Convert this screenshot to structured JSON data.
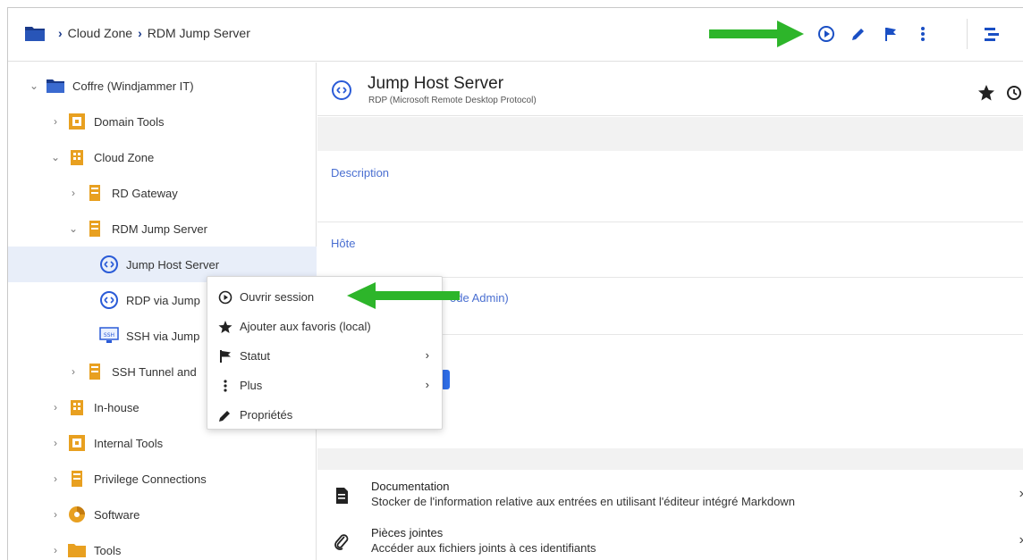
{
  "breadcrumb": {
    "items": [
      "Cloud Zone",
      "RDM Jump Server"
    ]
  },
  "toolbar": {
    "icons": [
      "play-circle-icon",
      "pencil-icon",
      "flag-icon",
      "more-vertical-icon",
      "tree-toggle-icon"
    ]
  },
  "tree": {
    "root": "Coffre (Windjammer IT)",
    "items": [
      {
        "label": "Domain Tools",
        "icon": "domain-tools-icon"
      },
      {
        "label": "Cloud Zone",
        "icon": "building-icon"
      },
      {
        "label": "RD Gateway",
        "icon": "server-icon"
      },
      {
        "label": "RDM Jump Server",
        "icon": "server-icon"
      },
      {
        "label": "Jump Host Server",
        "icon": "rdp-icon"
      },
      {
        "label": "RDP via Jump",
        "icon": "rdp-icon"
      },
      {
        "label": "SSH via Jump",
        "icon": "ssh-icon"
      },
      {
        "label": "SSH Tunnel and",
        "icon": "server-icon"
      },
      {
        "label": "In-house",
        "icon": "building-icon"
      },
      {
        "label": "Internal Tools",
        "icon": "domain-tools-icon"
      },
      {
        "label": "Privilege Connections",
        "icon": "server-icon"
      },
      {
        "label": "Software",
        "icon": "software-disc-icon"
      },
      {
        "label": "Tools",
        "icon": "folder-icon"
      }
    ]
  },
  "detail": {
    "title": "Jump Host Server",
    "subtitle": "RDP (Microsoft Remote Desktop Protocol)",
    "description_label": "Description",
    "host_label": "Hôte",
    "mode_admin_fragment": "ode Admin)",
    "documentation": {
      "title": "Documentation",
      "text": "Stocker de l'information relative aux entrées en utilisant l'éditeur intégré Markdown"
    },
    "attachments": {
      "title": "Pièces jointes",
      "text": "Accéder aux fichiers joints à ces identifiants"
    }
  },
  "context_menu": {
    "items": [
      {
        "label": "Ouvrir session",
        "icon": "play-circle-icon"
      },
      {
        "label": "Ajouter aux favoris (local)",
        "icon": "star-icon"
      },
      {
        "label": "Statut",
        "icon": "flag-icon",
        "submenu": true
      },
      {
        "label": "Plus",
        "icon": "more-vertical-icon",
        "submenu": true
      },
      {
        "label": "Propriétés",
        "icon": "pencil-icon"
      }
    ]
  },
  "colors": {
    "accent_blue": "#1a4fc4",
    "label_blue": "#4a6fd1",
    "folder_orange": "#e8a020",
    "green_arrow": "#2db52a",
    "selected_row": "#e8eef9"
  }
}
